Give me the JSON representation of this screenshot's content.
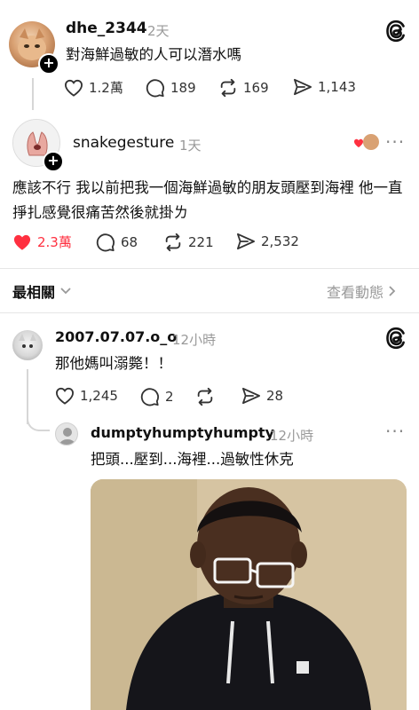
{
  "post1": {
    "username": "dhe_2344",
    "time": "2天",
    "text": "對海鮮過敏的人可以潛水嗎",
    "likes": "1.2萬",
    "comments": "189",
    "reposts": "169",
    "shares": "1,143"
  },
  "post2": {
    "username": "snakegesture",
    "time": "1天",
    "text": "應該不行 我以前把我一個海鮮過敏的朋友頭壓到海裡 他一直掙扎感覺很痛苦然後就掛ㄌ",
    "likes": "2.3萬",
    "comments": "68",
    "reposts": "221",
    "shares": "2,532"
  },
  "sort": {
    "label": "最相關",
    "activity_link": "查看動態"
  },
  "reply1": {
    "username": "2007.07.07.o_o",
    "time": "12小時",
    "text": "那他媽叫溺斃！！",
    "likes": "1,245",
    "comments": "2",
    "shares": "28"
  },
  "reply2": {
    "username": "dumptyhumptyhumpty",
    "time": "12小時",
    "text": "把頭...壓到...海裡...過敏性休克"
  },
  "colors": {
    "like_active": "#ff3040",
    "muted": "#999999"
  }
}
